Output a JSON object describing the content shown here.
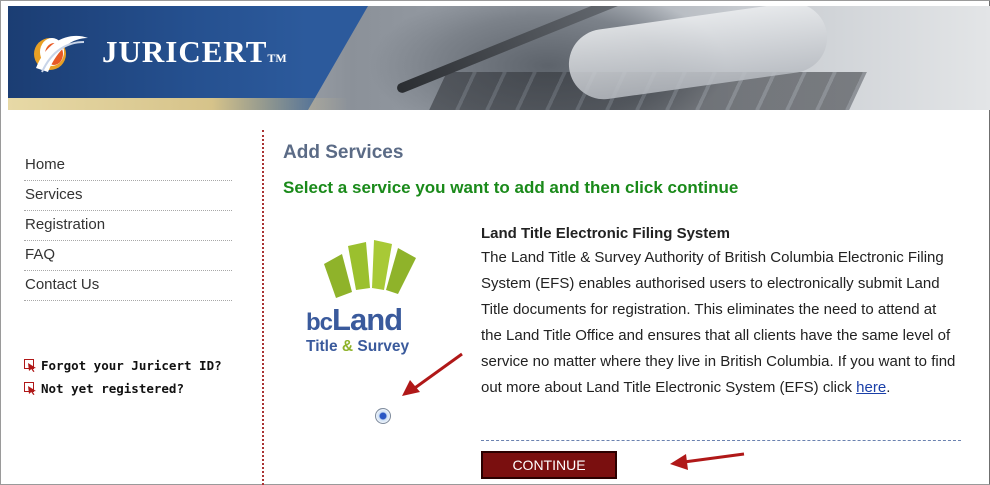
{
  "header": {
    "brand": "JURICERT",
    "trademark": "TM"
  },
  "nav": {
    "items": [
      {
        "label": "Home"
      },
      {
        "label": "Services"
      },
      {
        "label": "Registration"
      },
      {
        "label": "FAQ"
      },
      {
        "label": "Contact Us"
      }
    ]
  },
  "side_links": [
    {
      "label": "Forgot your Juricert ID?",
      "icon": "arrow-cursor-icon"
    },
    {
      "label": "Not yet registered?",
      "icon": "arrow-cursor-icon"
    }
  ],
  "main": {
    "title": "Add Services",
    "subtitle": "Select a service you want to add and then click continue",
    "service": {
      "logo_word": "Land",
      "logo_prefix": "bc",
      "logo_sub_1": "Title",
      "logo_sub_amp": "&",
      "logo_sub_2": "Survey",
      "name": "Land Title Electronic Filing System",
      "description": "The Land Title & Survey Authority of British Columbia Electronic Filing System (EFS) enables authorised users to electronically submit Land Title documents for registration. This eliminates the need to attend at the Land Title Office and ensures that all clients have the same level of service no matter where they live in British Columbia. If you want to find out more about Land Title Electronic System (EFS) click",
      "link_text": "here",
      "after_link": ".",
      "selected": true
    },
    "continue_label": "CONTINUE"
  },
  "colors": {
    "header_blue": "#25508f",
    "title": "#5b6b86",
    "subtitle_green": "#1a8a1a",
    "button_bg": "#7a0f0f",
    "annotation_arrow": "#b01818",
    "logo_green": "#8fb32a",
    "logo_blue": "#3a5a9c"
  }
}
